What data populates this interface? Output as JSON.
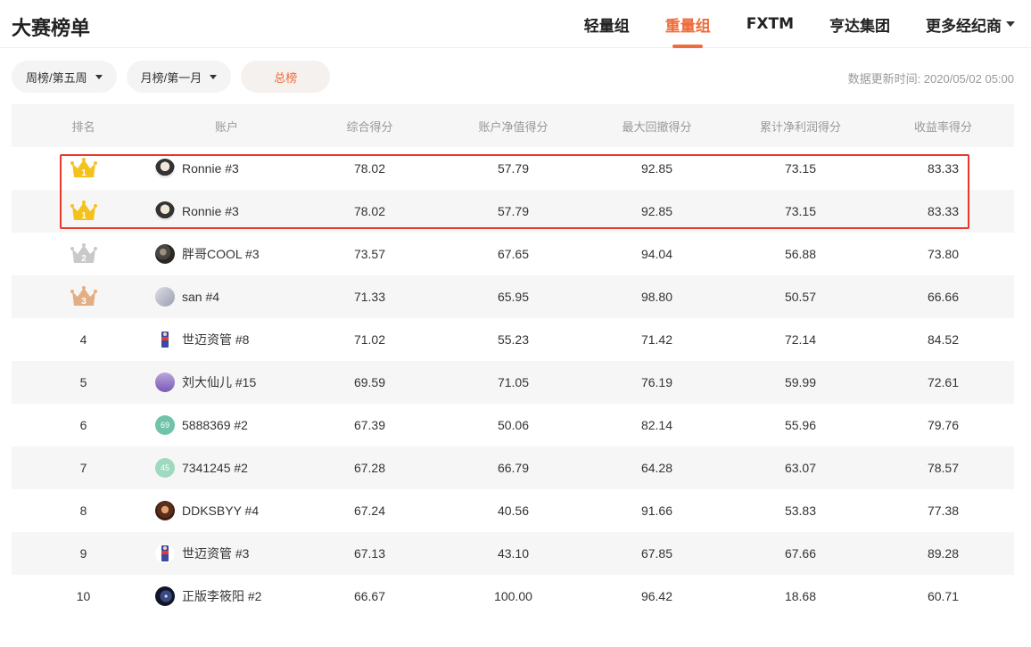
{
  "header": {
    "title": "大赛榜单",
    "tabs": [
      "轻量组",
      "重量组",
      "FXTM",
      "亨达集团",
      "更多经纪商"
    ],
    "active_tab": 1
  },
  "filters": {
    "weekly": "周榜/第五周",
    "monthly": "月榜/第一月",
    "total": "总榜"
  },
  "update_time": "数据更新时间: 2020/05/02 05:00",
  "table": {
    "headers": [
      "排名",
      "账户",
      "综合得分",
      "账户净值得分",
      "最大回撤得分",
      "累计净利润得分",
      "收益率得分"
    ],
    "rows": [
      {
        "rank": "1",
        "account": "Ronnie #3",
        "avatar": "ronnie-avatar",
        "s1": "78.02",
        "s2": "57.79",
        "s3": "92.85",
        "s4": "73.15",
        "s5": "83.33"
      },
      {
        "rank": "1",
        "account": "Ronnie #3",
        "avatar": "ronnie-avatar",
        "s1": "78.02",
        "s2": "57.79",
        "s3": "92.85",
        "s4": "73.15",
        "s5": "83.33"
      },
      {
        "rank": "2",
        "account": "胖哥COOL #3",
        "avatar": "cool-avatar",
        "s1": "73.57",
        "s2": "67.65",
        "s3": "94.04",
        "s4": "56.88",
        "s5": "73.80"
      },
      {
        "rank": "3",
        "account": "san #4",
        "avatar": "san-avatar",
        "s1": "71.33",
        "s2": "65.95",
        "s3": "98.80",
        "s4": "50.57",
        "s5": "66.66"
      },
      {
        "rank": "4",
        "account": "世迈资管 #8",
        "avatar": "shimai-avatar",
        "s1": "71.02",
        "s2": "55.23",
        "s3": "71.42",
        "s4": "72.14",
        "s5": "84.52"
      },
      {
        "rank": "5",
        "account": "刘大仙儿 #15",
        "avatar": "liu-avatar",
        "s1": "69.59",
        "s2": "71.05",
        "s3": "76.19",
        "s4": "59.99",
        "s5": "72.61"
      },
      {
        "rank": "6",
        "account": "5888369 #2",
        "avatar": "num-avatar",
        "avatar_text": "69",
        "s1": "67.39",
        "s2": "50.06",
        "s3": "82.14",
        "s4": "55.96",
        "s5": "79.76"
      },
      {
        "rank": "7",
        "account": "7341245 #2",
        "avatar": "num-avatar",
        "avatar_text": "45",
        "s1": "67.28",
        "s2": "66.79",
        "s3": "64.28",
        "s4": "63.07",
        "s5": "78.57"
      },
      {
        "rank": "8",
        "account": "DDKSBYY #4",
        "avatar": "ddk-avatar",
        "s1": "67.24",
        "s2": "40.56",
        "s3": "91.66",
        "s4": "53.83",
        "s5": "77.38"
      },
      {
        "rank": "9",
        "account": "世迈资管 #3",
        "avatar": "shimai-avatar",
        "s1": "67.13",
        "s2": "43.10",
        "s3": "67.85",
        "s4": "67.66",
        "s5": "89.28"
      },
      {
        "rank": "10",
        "account": "正版李筱阳 #2",
        "avatar": "zheng-avatar",
        "s1": "66.67",
        "s2": "100.00",
        "s3": "96.42",
        "s4": "18.68",
        "s5": "60.71"
      }
    ]
  },
  "colors": {
    "accent": "#f06b3a",
    "gold": "#f5c21b",
    "silver": "#c9c9c9",
    "bronze": "#e5ad82",
    "highlight_border": "#e8382c"
  }
}
